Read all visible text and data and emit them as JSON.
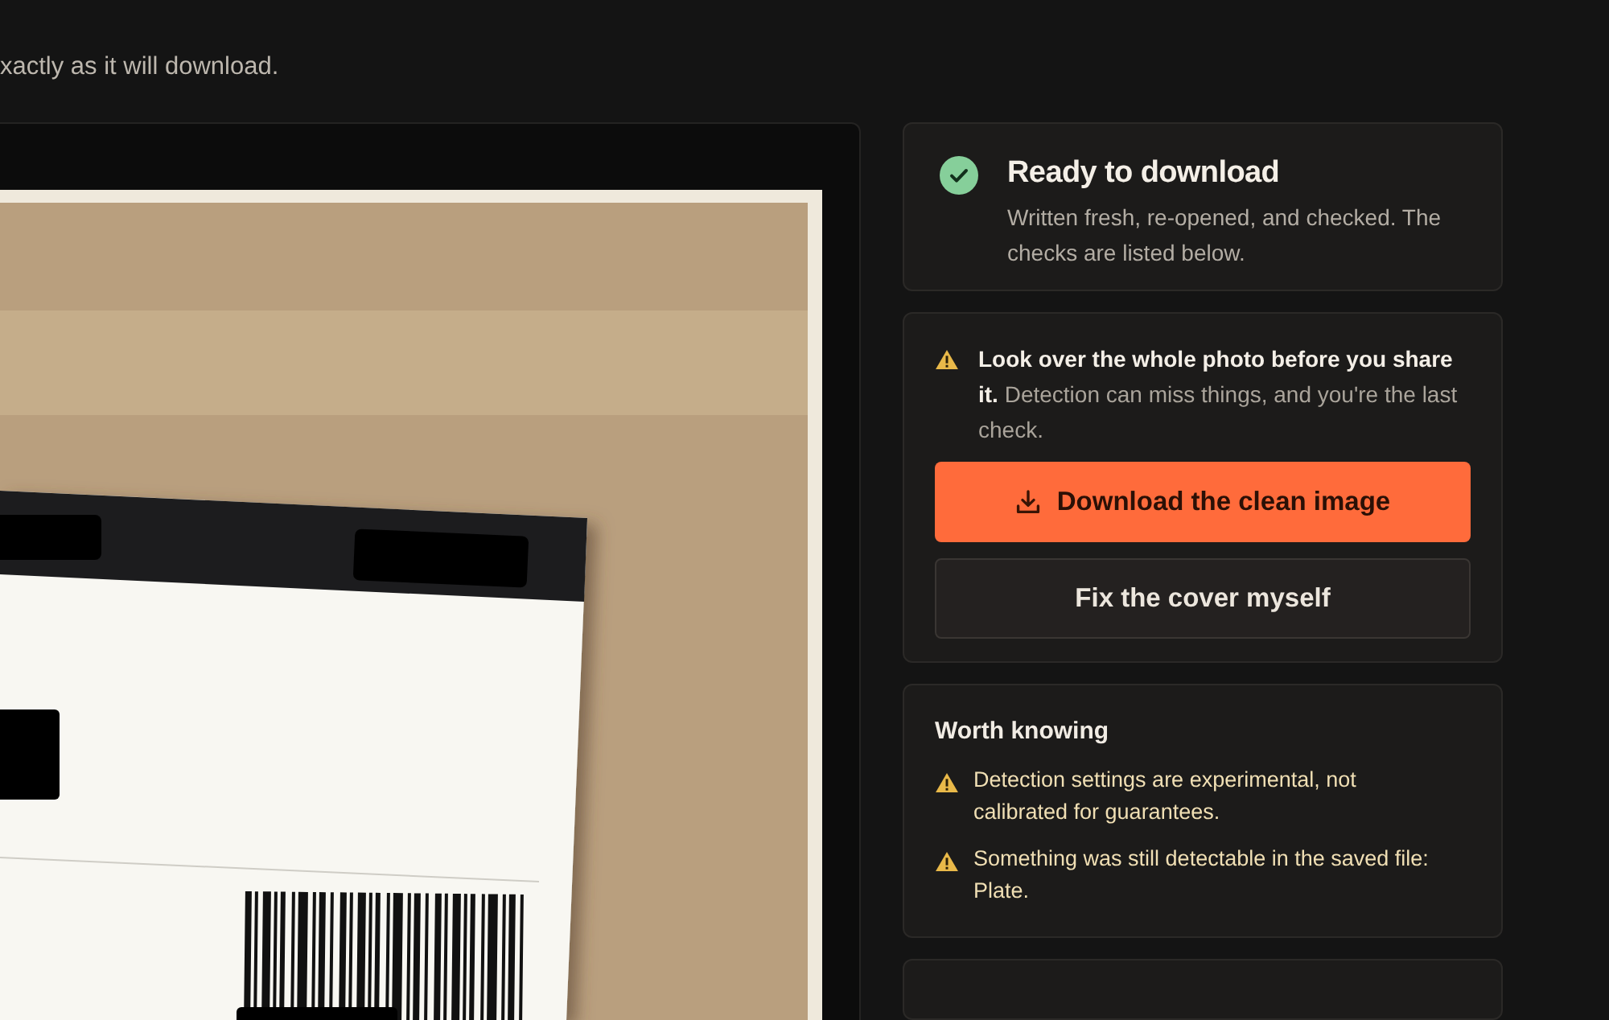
{
  "intro": "xactly as it will download.",
  "status": {
    "ready": true,
    "title": "Ready to download",
    "detail": "Written fresh, re-opened, and checked. The checks are listed below."
  },
  "warning": {
    "text": "**Look over the whole photo before you share it.** Detection can miss things, and you're the last check."
  },
  "buttons": [
    {
      "label": "Download the clean image",
      "kind": "primary"
    },
    {
      "label": "Fix the cover myself",
      "kind": "secondary"
    }
  ],
  "notes": {
    "title": "Worth knowing",
    "items": [
      "Detection settings are experimental, not calibrated for guarantees.",
      "Something was still detectable in the saved file: Plate."
    ]
  }
}
